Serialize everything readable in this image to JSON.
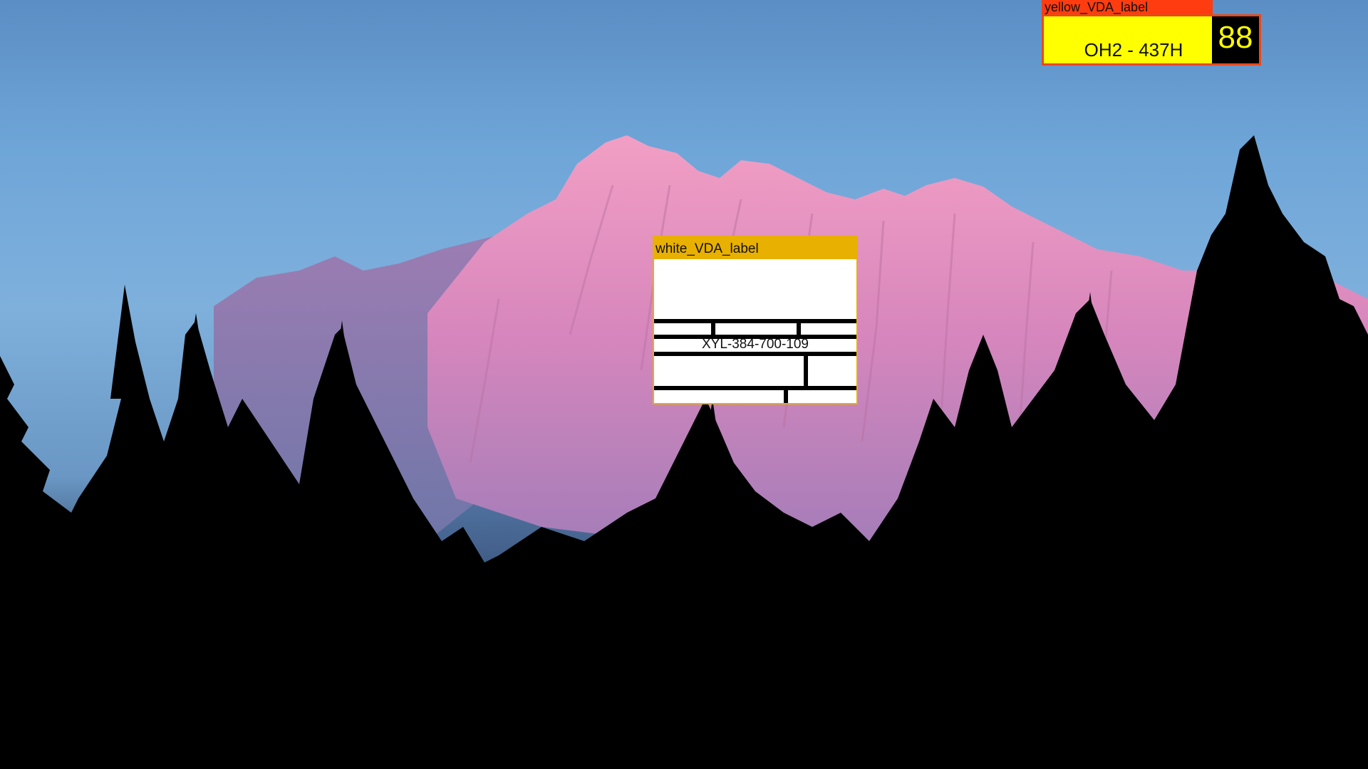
{
  "wallpaper": {
    "colors": {
      "sky_top": "#5b8ec4",
      "sky_mid": "#7fb0dc",
      "mountain_lit": "#e28fbe",
      "mountain_shadow": "#8c6fa6",
      "forest": "#000000"
    }
  },
  "yellow_label": {
    "title": "yellow_VDA_label",
    "code": "OH2 - 437H",
    "number": "88",
    "colors": {
      "title_bar": "#ff3c10",
      "body": "#ffff00",
      "number_bg": "#000000",
      "number_text": "#ffff00"
    }
  },
  "white_label": {
    "title": "white_VDA_label",
    "code": "XYL-384-700-109",
    "colors": {
      "title_bar": "#e8b000",
      "body": "#ffffff",
      "lines": "#000000"
    }
  }
}
